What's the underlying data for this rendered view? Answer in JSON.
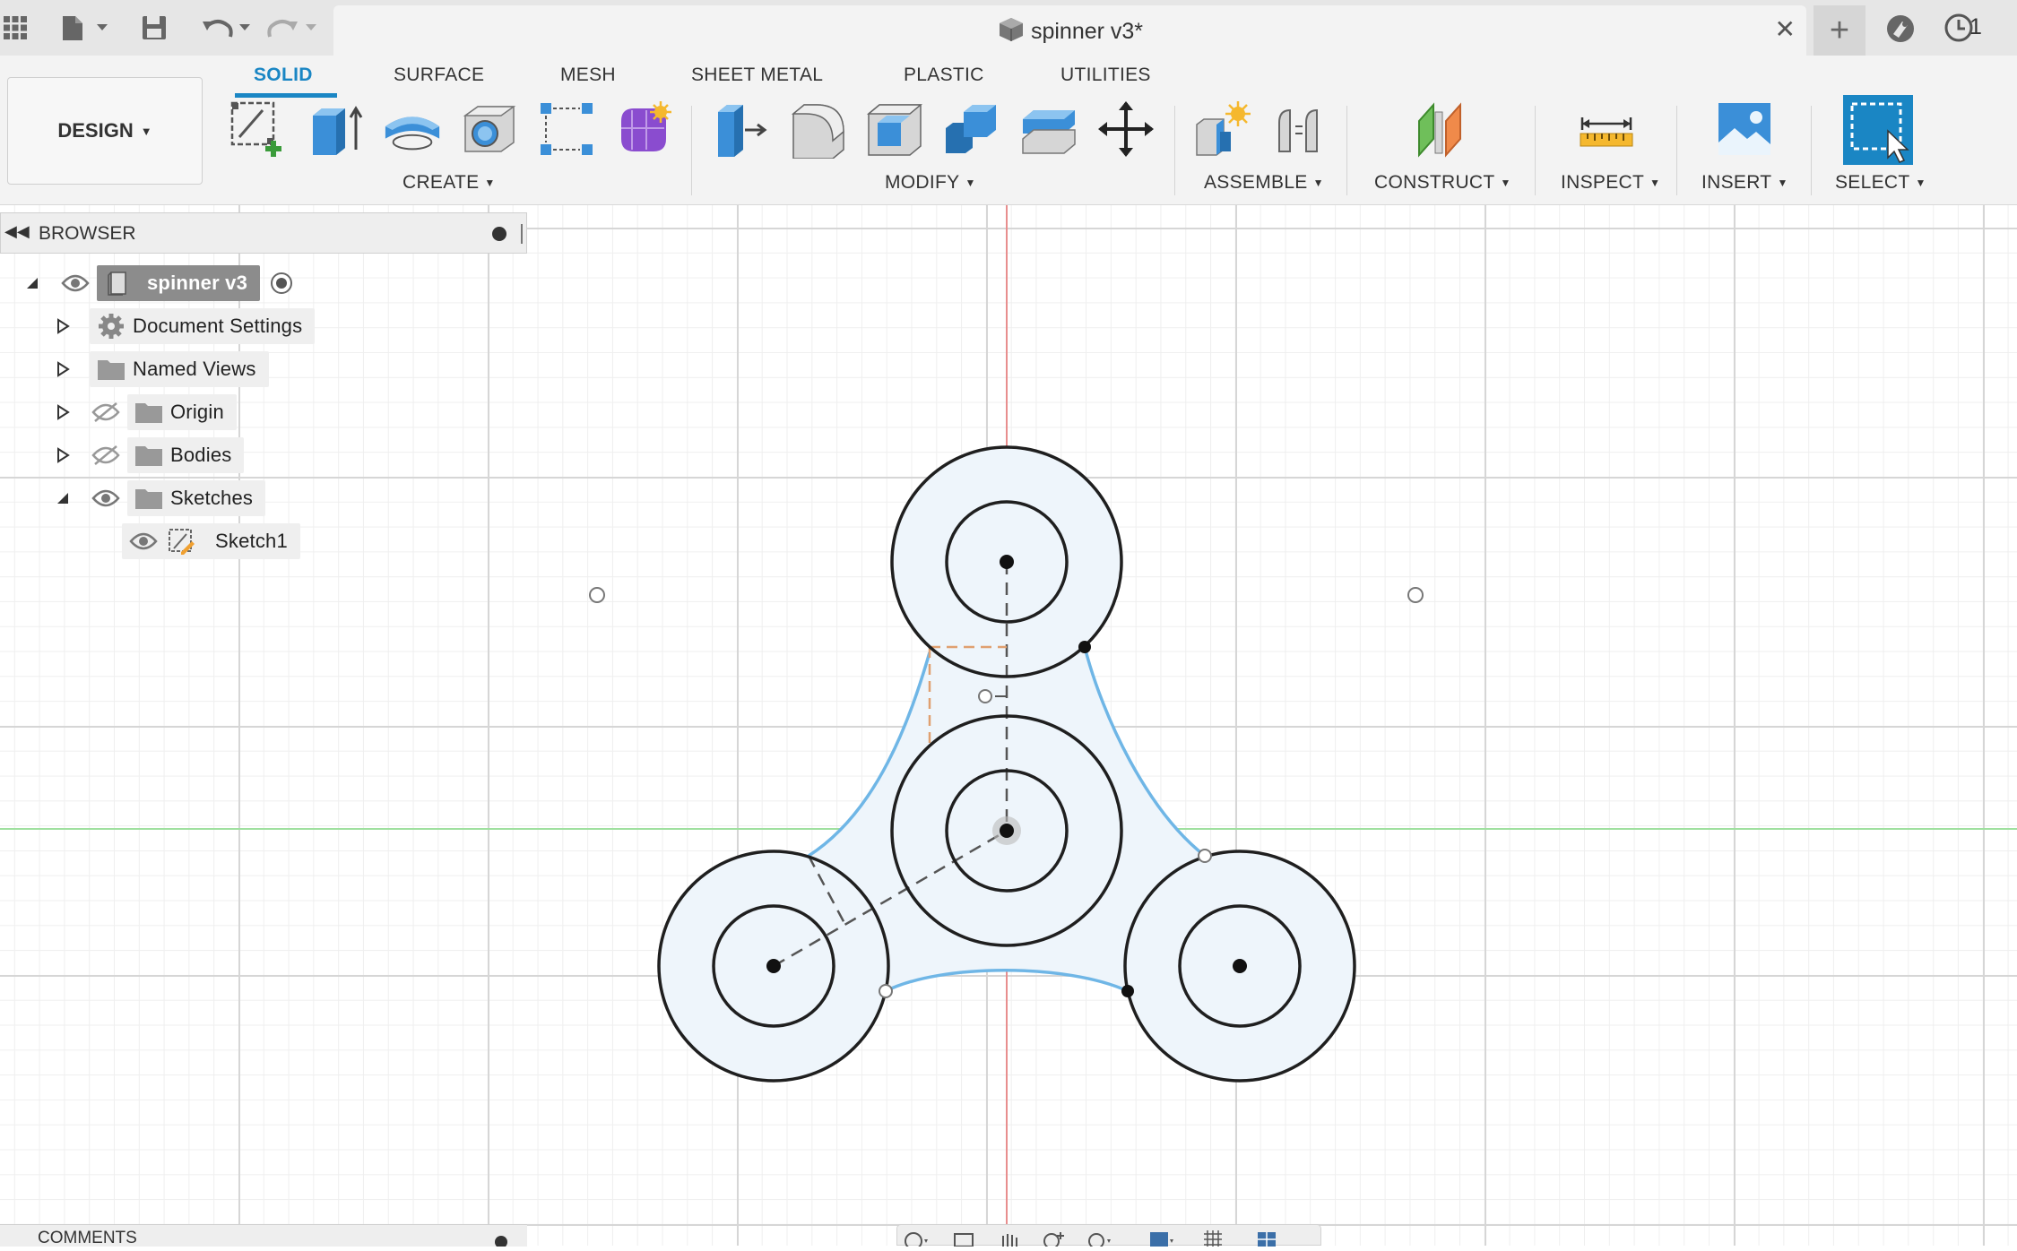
{
  "app": {
    "document_title": "spinner v3*",
    "job_count": "1"
  },
  "colors": {
    "accent": "#1a86c4",
    "sketch_line": "#1f1f1f",
    "constraint_curve": "#6fb6e6",
    "profile_fill": "#eef5fb",
    "axis_red": "#e88e8e",
    "axis_green": "#9fe09f"
  },
  "toolbar": {
    "design_label": "DESIGN",
    "tabs": [
      {
        "label": "SOLID",
        "active": true
      },
      {
        "label": "SURFACE",
        "active": false
      },
      {
        "label": "MESH",
        "active": false
      },
      {
        "label": "SHEET METAL",
        "active": false
      },
      {
        "label": "PLASTIC",
        "active": false
      },
      {
        "label": "UTILITIES",
        "active": false
      }
    ],
    "groups": {
      "create": "CREATE",
      "modify": "MODIFY",
      "assemble": "ASSEMBLE",
      "construct": "CONSTRUCT",
      "inspect": "INSPECT",
      "insert": "INSERT",
      "select": "SELECT"
    },
    "icons": {
      "create": [
        "create-sketch-icon",
        "extrude-icon",
        "revolve-icon",
        "hole-icon",
        "pattern-icon",
        "create-form-icon"
      ],
      "modify": [
        "press-pull-icon",
        "fillet-icon",
        "shell-icon",
        "combine-icon",
        "offset-face-icon",
        "move-icon"
      ],
      "assemble": [
        "new-component-icon",
        "joint-icon"
      ],
      "construct": "offset-plane-icon",
      "inspect": "measure-icon",
      "insert": "insert-image-icon",
      "select": "select-window-icon"
    }
  },
  "browser": {
    "title": "BROWSER",
    "root": "spinner v3",
    "items": [
      {
        "label": "Document Settings",
        "icon": "gear-icon"
      },
      {
        "label": "Named Views",
        "icon": "folder-icon"
      },
      {
        "label": "Origin",
        "icon": "folder-icon",
        "visible": false
      },
      {
        "label": "Bodies",
        "icon": "folder-icon",
        "visible": false
      },
      {
        "label": "Sketches",
        "icon": "folder-icon",
        "visible": true,
        "expanded": true
      },
      {
        "label": "Sketch1",
        "icon": "sketch-icon",
        "visible": true
      }
    ]
  },
  "comments": {
    "title": "COMMENTS"
  }
}
